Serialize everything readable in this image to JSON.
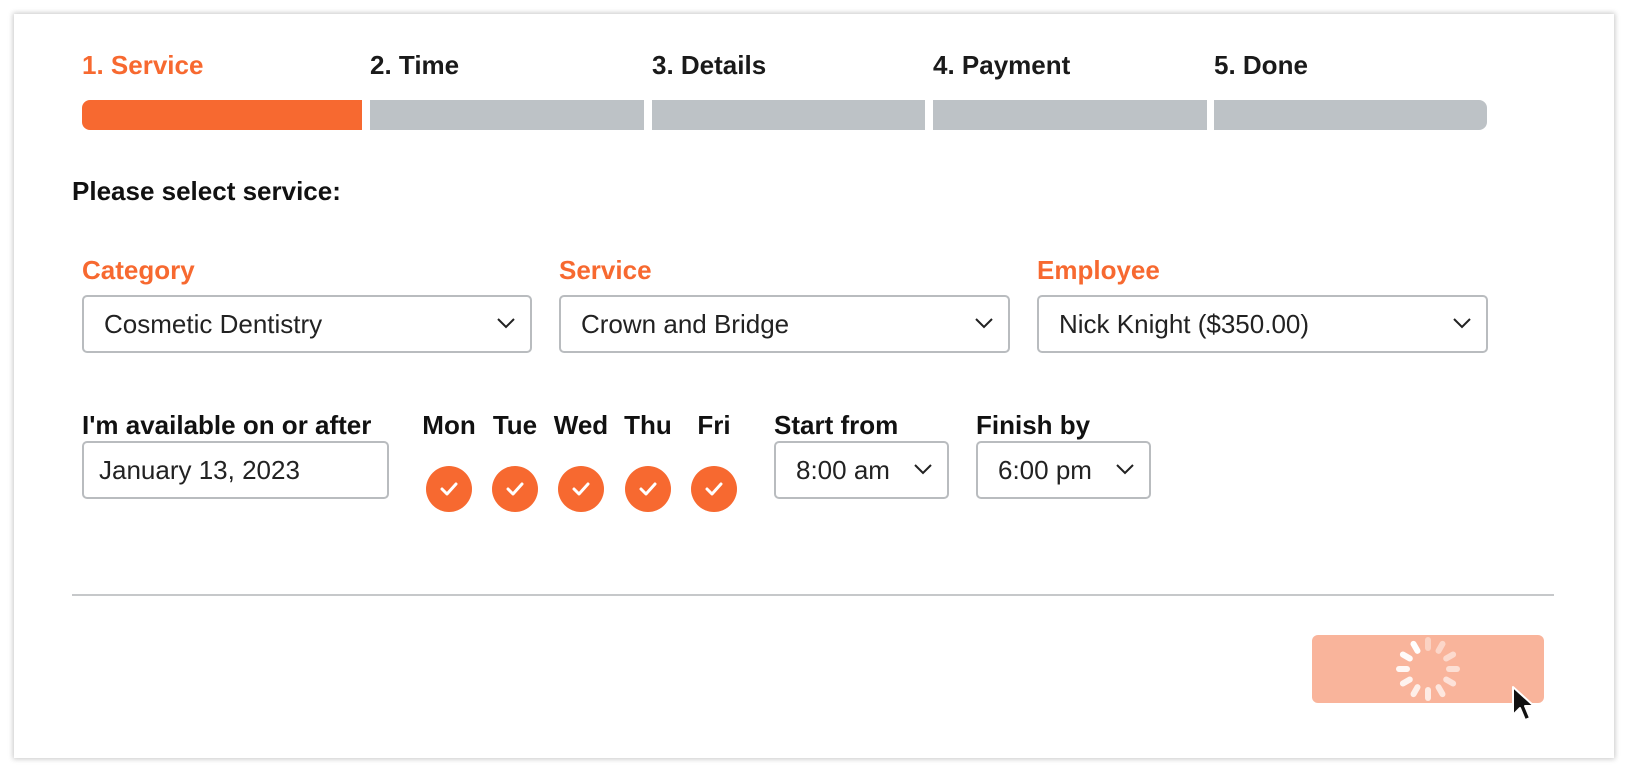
{
  "steps": [
    {
      "label": "1. Service",
      "active": true
    },
    {
      "label": "2. Time",
      "active": false
    },
    {
      "label": "3. Details",
      "active": false
    },
    {
      "label": "4. Payment",
      "active": false
    },
    {
      "label": "5. Done",
      "active": false
    }
  ],
  "progress": {
    "current_step": 1,
    "total_steps": 5
  },
  "heading": "Please select service:",
  "category": {
    "label": "Category",
    "value": "Cosmetic Dentistry"
  },
  "service": {
    "label": "Service",
    "value": "Crown and Bridge"
  },
  "employee": {
    "label": "Employee",
    "value": "Nick Knight ($350.00)"
  },
  "availability": {
    "date_label": "I'm available on or after",
    "date_value": "January 13, 2023",
    "days": [
      {
        "label": "Mon",
        "checked": true
      },
      {
        "label": "Tue",
        "checked": true
      },
      {
        "label": "Wed",
        "checked": true
      },
      {
        "label": "Thu",
        "checked": true
      },
      {
        "label": "Fri",
        "checked": true
      }
    ],
    "start_label": "Start from",
    "start_value": "8:00 am",
    "finish_label": "Finish by",
    "finish_value": "6:00 pm"
  },
  "next_button": {
    "state": "loading",
    "icon": "spinner-icon"
  },
  "colors": {
    "accent": "#f76930",
    "inactive_bar": "#bdc2c6",
    "button_loading": "#f9b49b"
  }
}
